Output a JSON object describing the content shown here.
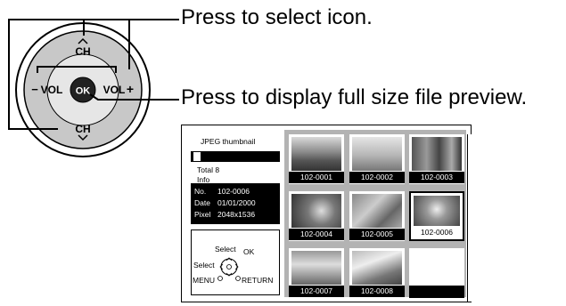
{
  "remote": {
    "ch_up": "CH",
    "ch_down": "CH",
    "vol_minus": "VOL",
    "vol_plus": "VOL",
    "ok": "OK",
    "minus_sign": "−",
    "plus_sign": "+"
  },
  "callouts": {
    "select": "Press to select icon.",
    "preview": "Press to display full size file preview."
  },
  "screen": {
    "heading": "JPEG thumbnail",
    "total": "Total 8",
    "info_label": "Info",
    "info": [
      {
        "key": "No.",
        "value": "102-0006"
      },
      {
        "key": "Date",
        "value": "01/01/2000"
      },
      {
        "key": "Pixel",
        "value": "2048x1536"
      }
    ],
    "help": {
      "select_ok": "Select",
      "ok": "OK",
      "select_left": "Select",
      "menu": "MENU",
      "return": "RETURN"
    },
    "thumbnails": [
      {
        "label": "102-0001",
        "selected": false
      },
      {
        "label": "102-0002",
        "selected": false
      },
      {
        "label": "102-0003",
        "selected": false
      },
      {
        "label": "102-0004",
        "selected": false
      },
      {
        "label": "102-0005",
        "selected": false
      },
      {
        "label": "102-0006",
        "selected": true
      },
      {
        "label": "102-0007",
        "selected": false
      },
      {
        "label": "102-0008",
        "selected": false
      }
    ]
  }
}
